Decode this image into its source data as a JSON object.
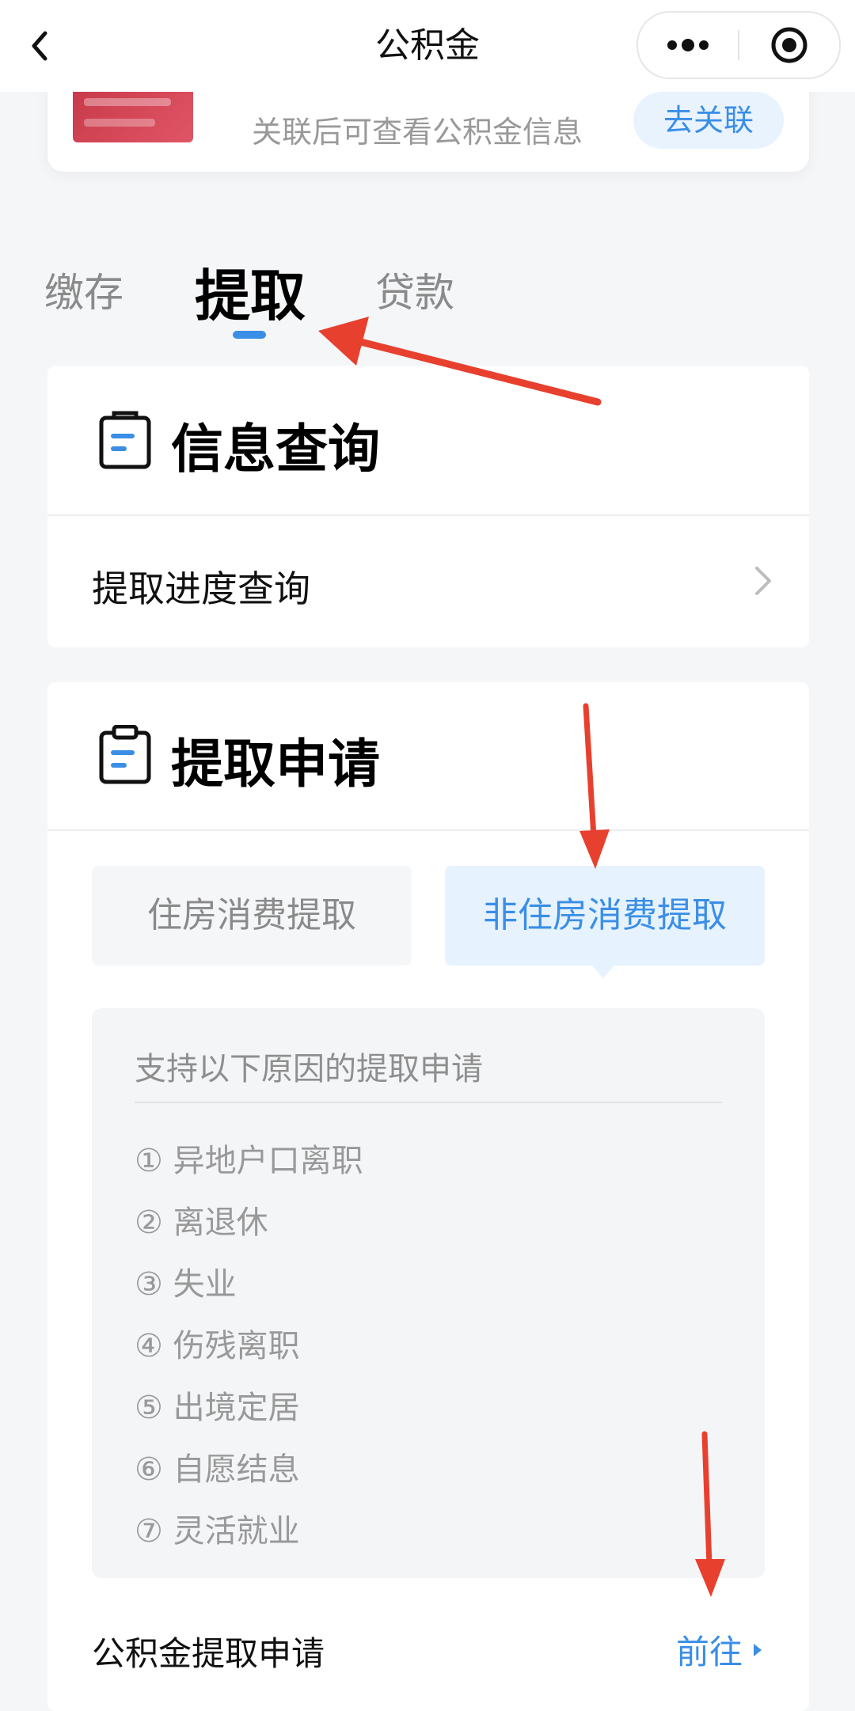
{
  "nav": {
    "title": "公积金",
    "more_icon": "more-dots-icon",
    "close_icon": "target-circle-icon"
  },
  "link_card": {
    "subtitle": "关联后可查看公积金信息",
    "button": "去关联"
  },
  "tabs": [
    {
      "label": "缴存",
      "active": false
    },
    {
      "label": "提取",
      "active": true
    },
    {
      "label": "贷款",
      "active": false
    }
  ],
  "info_section": {
    "title": "信息查询",
    "rows": [
      {
        "label": "提取进度查询"
      }
    ]
  },
  "apply_section": {
    "title": "提取申请",
    "segments": [
      {
        "label": "住房消费提取",
        "active": false
      },
      {
        "label": "非住房消费提取",
        "active": true
      }
    ],
    "reasons_heading": "支持以下原因的提取申请",
    "reasons": [
      "① 异地户口离职",
      "② 离退休",
      "③ 失业",
      "④ 伤残离职",
      "⑤ 出境定居",
      "⑥ 自愿结息",
      "⑦ 灵活就业"
    ],
    "goto_label": "公积金提取申请",
    "goto_link": "前往"
  },
  "colors": {
    "accent": "#3a8ee6",
    "annotation_arrow": "#e8402e",
    "card_image": "#c83a4a"
  }
}
